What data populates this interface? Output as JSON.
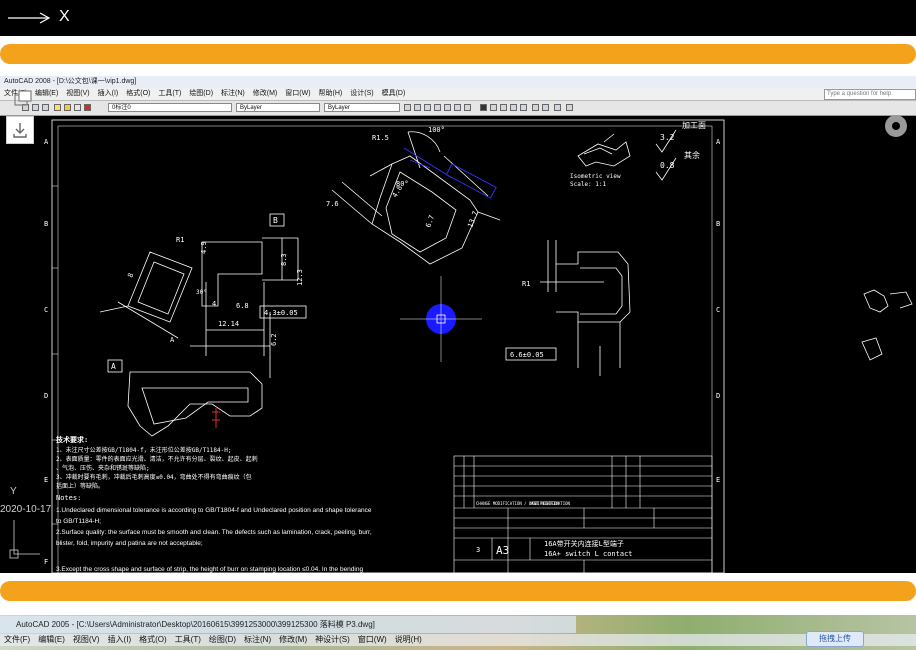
{
  "top_bar": {
    "close_glyph": "X"
  },
  "cad1": {
    "title": "AutoCAD 2008 - [D:\\公文包\\课一\\vip1.dwg]",
    "help_placeholder": "Type a question for help",
    "menus": [
      "文件(F)",
      "编辑(E)",
      "视图(V)",
      "插入(I)",
      "格式(O)",
      "工具(T)",
      "绘图(D)",
      "标注(N)",
      "修改(M)",
      "窗口(W)",
      "帮助(H)",
      "设计(S)",
      "模具(D)"
    ],
    "layer_combo": "0标注0",
    "linetype_combo": "ByLayer",
    "color_combo": "ByLayer",
    "lineweight_combo": "ByLayer",
    "date_overlay": "2020-10-17",
    "axis_label": "Y",
    "drawing": {
      "dims": [
        "R1.5",
        "100°",
        "7.6",
        "80°",
        "4.8",
        "6.7",
        "13.7",
        "B",
        "4.9",
        "8.3",
        "12.3",
        "R1",
        "8",
        "30°",
        "4",
        "6.8",
        "12.14",
        "4.3±0.05",
        "A",
        "6.2",
        "R1",
        "6.6±0.05",
        "3.2",
        "0.8"
      ],
      "corner_text": {
        "finish": "加工面",
        "other": "其余"
      },
      "iso_view": "Isometric view",
      "iso_scale": "Scale:  1:1",
      "notes_title": "技术要求:",
      "notes_cn": [
        "1、未注尺寸公差按GB/T1804-f，未注形位公差按GB/T1184-H;",
        "2、表面质量：零件的表面应光滑、清洁，不允许有分层、裂纹、起皮、起刺",
        "   、气泡、压伤、夹杂和锈斑等缺陷;",
        "3、冲裁时要有毛刺，冲裁后毛刺高度≤0.04，弯曲处不得有弯曲痕纹（包",
        "   括面上）等缺陷。"
      ],
      "notes_en_title": "Notes:",
      "notes_en": [
        "1.Undeclared dimensional tolerance is according to GB/T1804-f and Undeclared position and shape tolerance",
        "to GB/T1184-H;",
        "2.Surface quality: the surface must be smooth and clean. The defects such as lamination, crack, peeling, burr,",
        "blister, fold, impurity and patina are not acceptable;",
        "3.Except the cross shape and surface of strip, the height of burr on stamping location ≤0.04. In the bending"
      ],
      "title_block": {
        "cn_name": "16A带开关内连接L型端子",
        "en_name": "16A+ switch L contact",
        "sheet": "A3",
        "scale": "3",
        "modification": "MODIFICATION",
        "heading": "CHANGE MODIFICATION / LAST MODIFICATION"
      },
      "border_letters": [
        "A",
        "B",
        "C",
        "D",
        "E",
        "F"
      ]
    }
  },
  "cad2": {
    "title": "AutoCAD 2005 - [C:\\Users\\Administrator\\Desktop\\20160615\\3991253000\\399125300 落料模 P3.dwg]",
    "menus": [
      "文件(F)",
      "编辑(E)",
      "视图(V)",
      "插入(I)",
      "格式(O)",
      "工具(T)",
      "绘图(D)",
      "标注(N)",
      "修改(M)",
      "神设计(S)",
      "窗口(W)",
      "说明(H)"
    ],
    "upload_label": "拖拽上传"
  },
  "colors": {
    "accent_bar": "#f4a11c",
    "cursor_blue": "#1a1aff",
    "cad_bg": "#000000"
  }
}
